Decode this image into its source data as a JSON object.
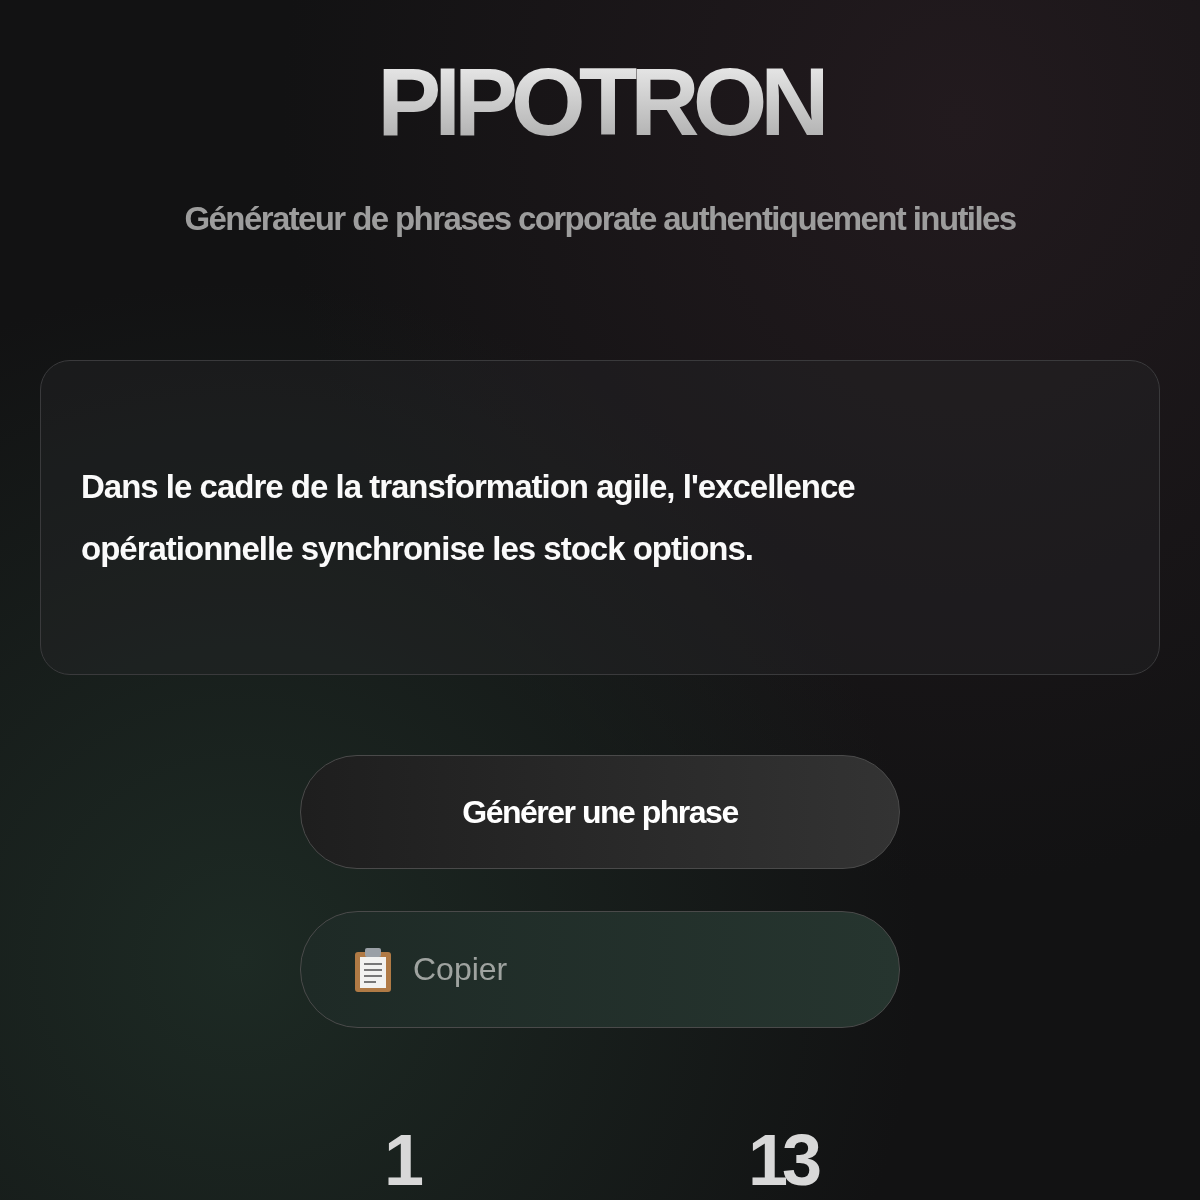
{
  "title": "PIPOTRON",
  "subtitle": "Générateur de phrases corporate authentiquement inutiles",
  "phrase": "Dans le cadre de la transformation agile, l'excellence opérationnelle synchronise les stock options.",
  "buttons": [
    {
      "kind": "generate",
      "label": "Générer une phrase"
    },
    {
      "kind": "copy",
      "label": "Copier"
    }
  ],
  "stats": [
    {
      "value": "1"
    },
    {
      "value": "13"
    }
  ]
}
